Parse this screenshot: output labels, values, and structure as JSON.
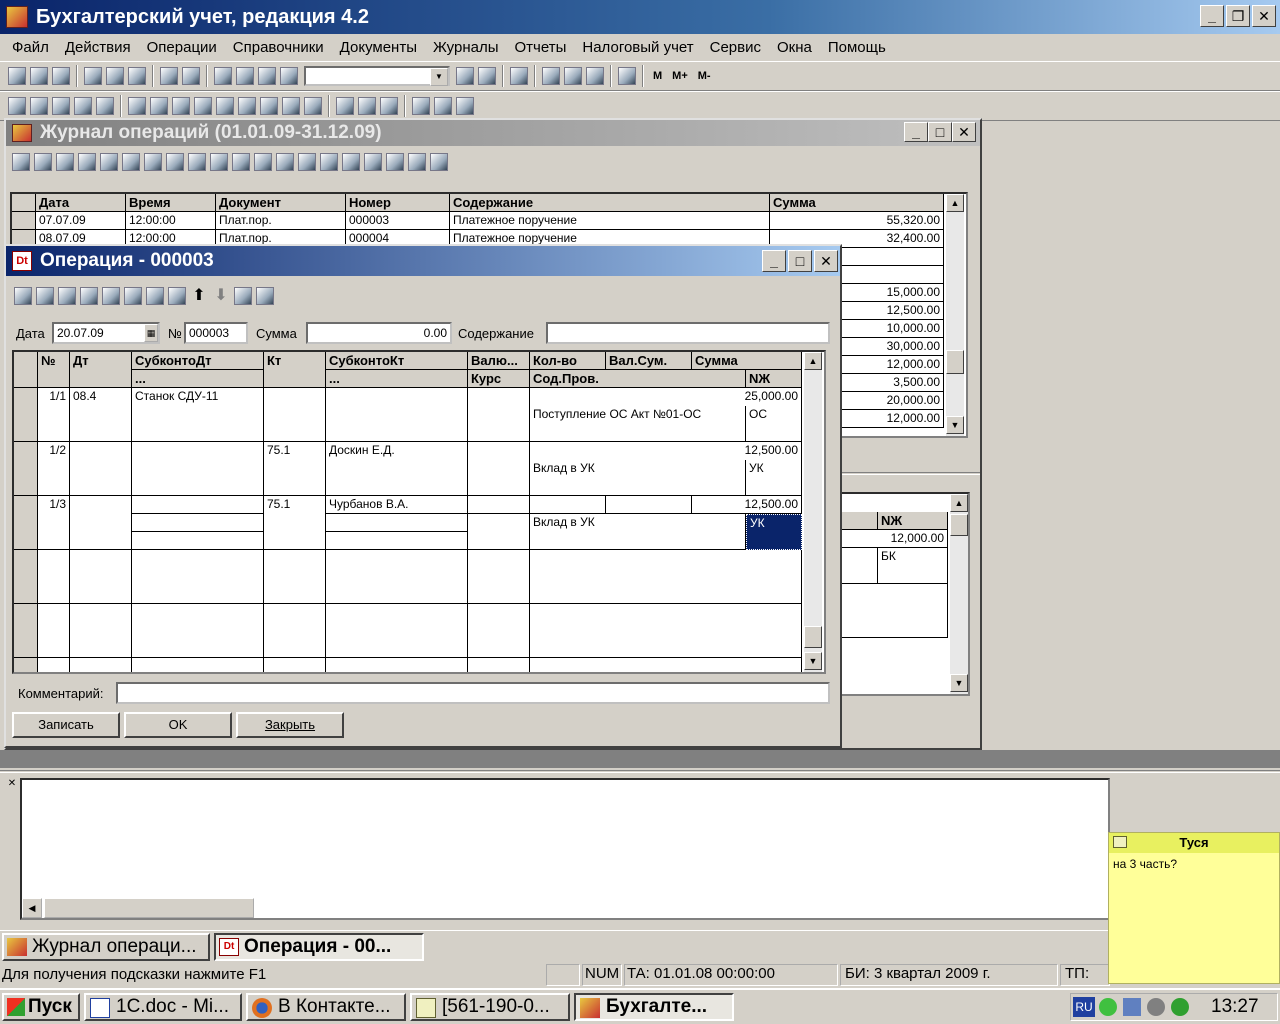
{
  "app": {
    "title": "Бухгалтерский учет, редакция 4.2"
  },
  "menu": [
    "Файл",
    "Действия",
    "Операции",
    "Справочники",
    "Документы",
    "Журналы",
    "Отчеты",
    "Налоговый учет",
    "Сервис",
    "Окна",
    "Помощь"
  ],
  "toolbar": {
    "mem_buttons": [
      "M",
      "M+",
      "M-"
    ]
  },
  "journal": {
    "title": "Журнал операций  (01.01.09-31.12.09)",
    "columns": [
      "Дата",
      "Время",
      "Документ",
      "Номер",
      "Содержание",
      "Сумма"
    ],
    "rows": [
      {
        "date": "07.07.09",
        "time": "12:00:00",
        "doc": "Плат.пор.",
        "num": "000003",
        "content": "Платежное поручение",
        "sum": "55,320.00"
      },
      {
        "date": "08.07.09",
        "time": "12:00:00",
        "doc": "Плат.пор.",
        "num": "000004",
        "content": "Платежное поручение",
        "sum": "32,400.00"
      }
    ],
    "visible_sums": [
      "15,000.00",
      "12,500.00",
      "10,000.00",
      "30,000.00",
      "12,000.00",
      "3,500.00",
      "20,000.00",
      "12,000.00"
    ],
    "lower": {
      "col_nzh": "NЖ",
      "sum": "12,000.00",
      "code": "БК"
    }
  },
  "operation": {
    "title": "Операция - 000003",
    "date_label": "Дата",
    "date": "20.07.09",
    "num_label": "№",
    "num": "000003",
    "sum_label": "Сумма",
    "sum": "0.00",
    "content_label": "Содержание",
    "content": "",
    "headers": {
      "n": "№",
      "dt": "Дт",
      "subdt": "СубконтоДт",
      "subdt2": "...",
      "kt": "Кт",
      "subkt": "СубконтоКт",
      "subkt2": "...",
      "val": "Валю...",
      "kurs": "Курс",
      "qty": "Кол-во",
      "valsum": "Вал.Сум.",
      "sum": "Сумма",
      "sod": "Сод.Пров.",
      "nzh": "NЖ"
    },
    "rows": [
      {
        "n": "1/1",
        "dt": "08.4",
        "subdt": "Станок СДУ-11",
        "kt": "",
        "subkt": "",
        "sum": "25,000.00",
        "sod": "Поступление ОС Акт №01-ОС",
        "nzh": "ОС"
      },
      {
        "n": "1/2",
        "dt": "",
        "subdt": "",
        "kt": "75.1",
        "subkt": "Доскин Е.Д.",
        "sum": "12,500.00",
        "sod": "Вклад в УК",
        "nzh": "УК"
      },
      {
        "n": "1/3",
        "dt": "",
        "subdt": "",
        "kt": "75.1",
        "subkt": "Чурбанов В.А.",
        "sum": "12,500.00",
        "sod": "Вклад в УК",
        "nzh": "УК"
      }
    ],
    "comment_label": "Комментарий:",
    "comment": "",
    "buttons": {
      "save": "Записать",
      "ok": "OK",
      "close": "Закрыть"
    }
  },
  "window_tabs": [
    "Журнал операци...",
    "Операция - 00..."
  ],
  "status": {
    "hint": "Для получения подсказки нажмите F1",
    "num": "NUM",
    "ta": "ТА: 01.01.08  00:00:00",
    "bi": "БИ: 3 квартал 2009 г.",
    "tp": "ТП:"
  },
  "sticky": {
    "title": "Туся",
    "text": "на 3 часть?"
  },
  "taskbar": {
    "start": "Пуск",
    "tasks": [
      "1C.doc - Mi...",
      "В Контакте...",
      "[561-190-0...",
      "Бухгалте..."
    ],
    "lang": "RU",
    "clock": "13:27"
  }
}
